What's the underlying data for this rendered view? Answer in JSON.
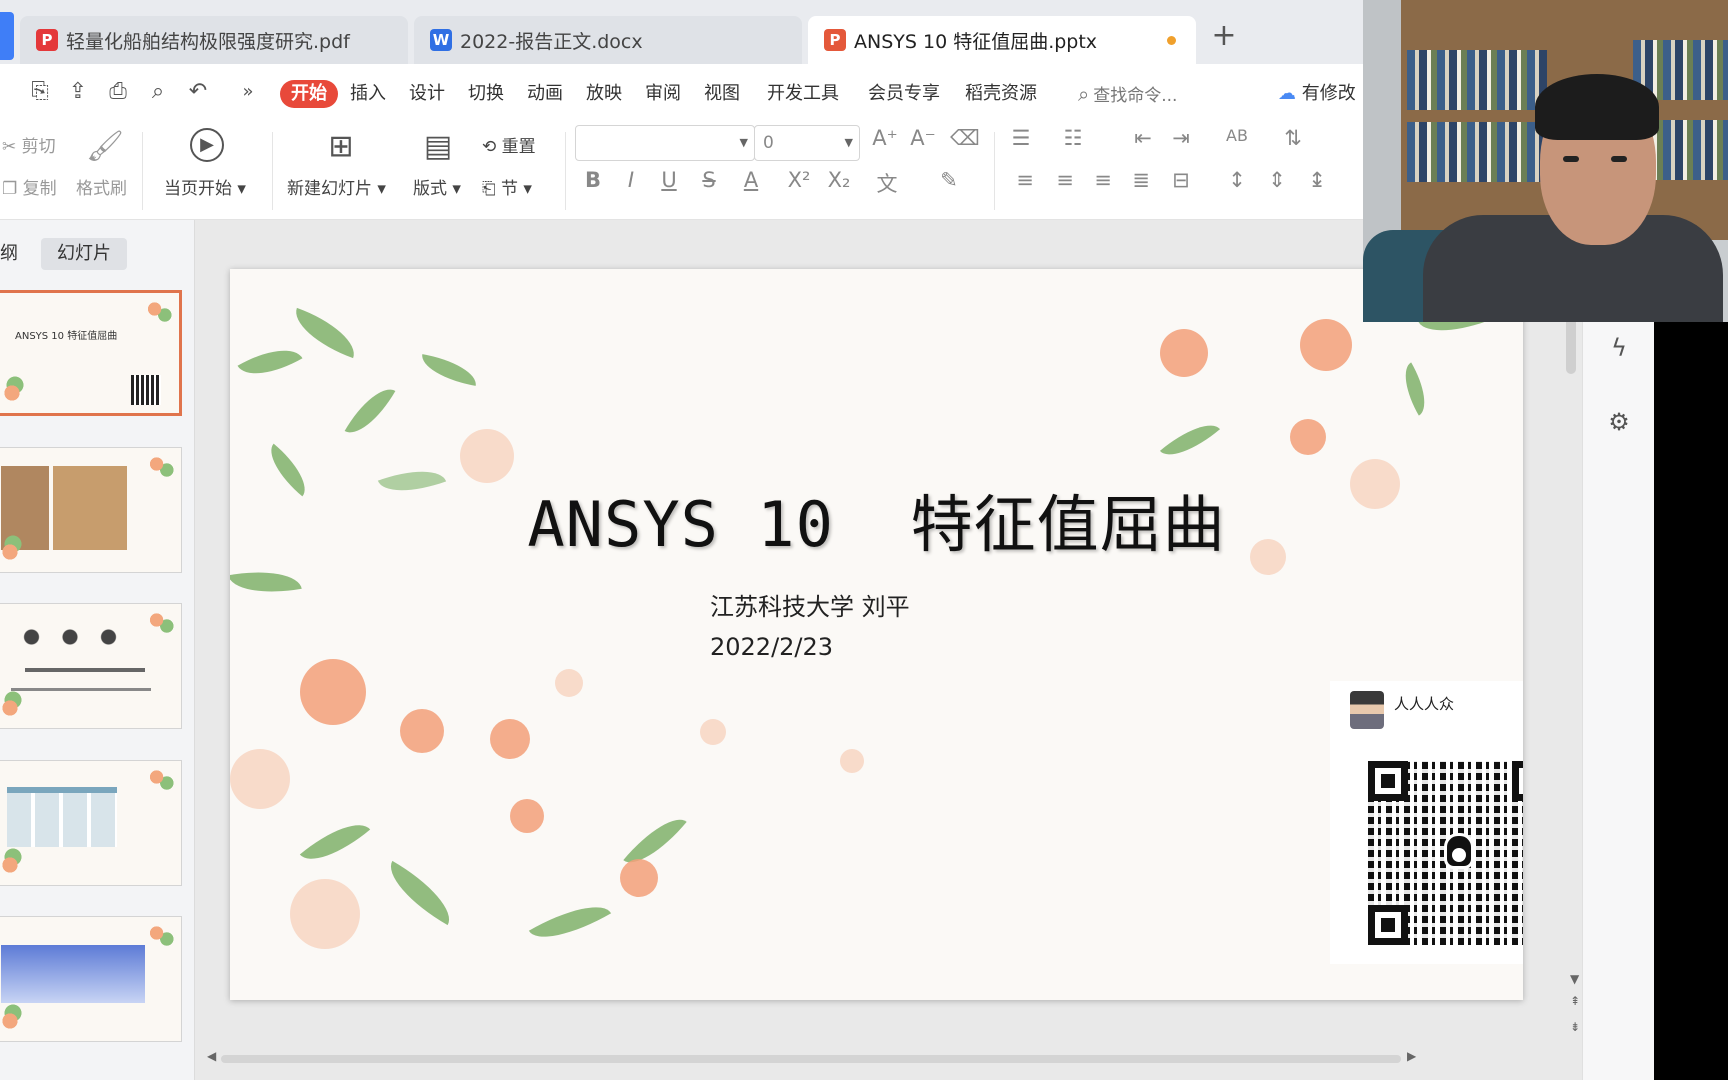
{
  "tabs": [
    {
      "label": "轻量化船舶结构极限强度研究.pdf",
      "icon": "pdf-icon",
      "icon_glyph": "P",
      "color": "#e4383a"
    },
    {
      "label": "2022-报告正文.docx",
      "icon": "word-icon",
      "icon_glyph": "W",
      "color": "#2f6fe4"
    },
    {
      "label": "ANSYS 10 特征值屈曲.pptx",
      "icon": "ppt-icon",
      "icon_glyph": "P",
      "color": "#e4583a"
    }
  ],
  "tab_add": "+",
  "menu": {
    "quick_access_more": "»",
    "items": [
      "开始",
      "插入",
      "设计",
      "切换",
      "动画",
      "放映",
      "审阅",
      "视图",
      "开发工具",
      "会员专享",
      "稻壳资源"
    ],
    "search": "查找命令...",
    "has_change": "有修改"
  },
  "ribbon": {
    "cut": "剪切",
    "copy": "复制",
    "format_painter": "格式刷",
    "play_from_current": "当页开始",
    "new_slide": "新建幻灯片",
    "layout": "版式",
    "reset": "重置",
    "section": "节",
    "font_size_value": "0"
  },
  "left_panel": {
    "tab_outline": "纲",
    "tab_slides": "幻灯片",
    "thumb1_title": "ANSYS 10 特征值屈曲"
  },
  "slide": {
    "title_latin": "ANSYS 10",
    "title_cn": "特征值屈曲",
    "author_line": "江苏科技大学    刘平",
    "date": "2022/2/23",
    "qq_name": "人人人众"
  },
  "colors": {
    "accent_red": "#e8493a",
    "selected_thumb_border": "#e0744c",
    "tab_bar_bg": "#e9ebef"
  }
}
